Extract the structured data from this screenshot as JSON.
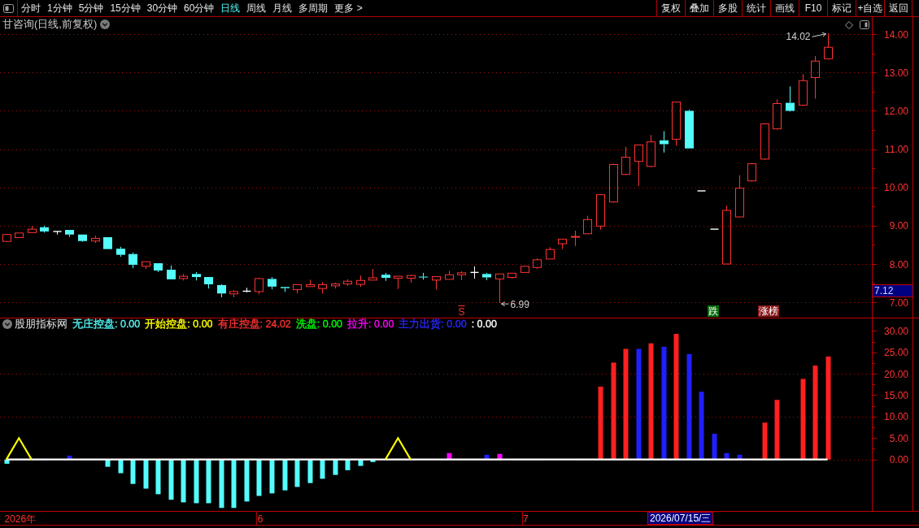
{
  "toolbar": {
    "periods": [
      {
        "label": "分时",
        "selected": false
      },
      {
        "label": "1分钟",
        "selected": false
      },
      {
        "label": "5分钟",
        "selected": false
      },
      {
        "label": "15分钟",
        "selected": false
      },
      {
        "label": "30分钟",
        "selected": false
      },
      {
        "label": "60分钟",
        "selected": false
      },
      {
        "label": "日线",
        "selected": true
      },
      {
        "label": "周线",
        "selected": false
      },
      {
        "label": "月线",
        "selected": false
      },
      {
        "label": "多周期",
        "selected": false
      },
      {
        "label": "更多 >",
        "selected": false
      }
    ],
    "buttons": [
      "复权",
      "叠加",
      "多股",
      "统计",
      "画线",
      "F10",
      "标记",
      "+自选",
      "返回"
    ]
  },
  "price_pane": {
    "title": "甘咨询(日线,前复权)",
    "markers": [
      {
        "kind": "signal",
        "text": "S"
      },
      {
        "kind": "tag",
        "text": "跌",
        "color": "#0b6b0b"
      },
      {
        "kind": "tag",
        "text": "涨榜",
        "color": "#8b1a1a"
      }
    ],
    "chart_data": [
      {
        "type": "candlestick",
        "ohlc": [
          [
            8.59,
            8.79,
            8.59,
            8.77
          ],
          [
            8.69,
            8.81,
            8.69,
            8.81
          ],
          [
            8.82,
            8.99,
            8.82,
            8.91
          ],
          [
            8.96,
            9,
            8.82,
            8.85
          ],
          [
            8.85,
            8.85,
            8.77,
            8.85
          ],
          [
            8.89,
            8.89,
            8.71,
            8.77
          ],
          [
            8.77,
            8.77,
            8.58,
            8.6
          ],
          [
            8.6,
            8.74,
            8.55,
            8.67
          ],
          [
            8.7,
            8.7,
            8.39,
            8.39
          ],
          [
            8.4,
            8.45,
            8.19,
            8.24
          ],
          [
            8.26,
            8.3,
            7.89,
            7.98
          ],
          [
            7.94,
            8.06,
            7.87,
            8.06
          ],
          [
            8.02,
            8.02,
            7.79,
            7.83
          ],
          [
            7.85,
            7.96,
            7.6,
            7.6
          ],
          [
            7.62,
            7.74,
            7.57,
            7.68
          ],
          [
            7.74,
            7.79,
            7.57,
            7.66
          ],
          [
            7.66,
            7.66,
            7.36,
            7.47
          ],
          [
            7.45,
            7.47,
            7.13,
            7.23
          ],
          [
            7.22,
            7.32,
            7.13,
            7.28
          ],
          [
            7.29,
            7.38,
            7.26,
            7.29
          ],
          [
            7.28,
            7.64,
            7.21,
            7.62
          ],
          [
            7.61,
            7.66,
            7.34,
            7.41
          ],
          [
            7.4,
            7.4,
            7.27,
            7.37
          ],
          [
            7.33,
            7.46,
            7.23,
            7.46
          ],
          [
            7.41,
            7.59,
            7.41,
            7.46
          ],
          [
            7.36,
            7.53,
            7.23,
            7.46
          ],
          [
            7.43,
            7.51,
            7.36,
            7.48
          ],
          [
            7.48,
            7.6,
            7.43,
            7.55
          ],
          [
            7.47,
            7.7,
            7.4,
            7.57
          ],
          [
            7.58,
            7.87,
            7.58,
            7.64
          ],
          [
            7.72,
            7.77,
            7.56,
            7.64
          ],
          [
            7.63,
            7.68,
            7.35,
            7.68
          ],
          [
            7.63,
            7.72,
            7.51,
            7.7
          ],
          [
            7.67,
            7.77,
            7.59,
            7.66
          ],
          [
            7.58,
            7.67,
            7.33,
            7.67
          ],
          [
            7.6,
            7.82,
            7.6,
            7.72
          ],
          [
            7.72,
            7.81,
            7.58,
            7.77
          ],
          [
            7.78,
            7.94,
            7.62,
            7.78
          ],
          [
            7.74,
            7.77,
            7.58,
            7.65
          ],
          [
            7.61,
            7.74,
            6.99,
            7.74
          ],
          [
            7.65,
            7.76,
            7.62,
            7.76
          ],
          [
            7.78,
            7.94,
            7.78,
            7.94
          ],
          [
            7.91,
            8.15,
            7.87,
            8.11
          ],
          [
            8.13,
            8.44,
            8.12,
            8.38
          ],
          [
            8.53,
            8.65,
            8.39,
            8.65
          ],
          [
            8.7,
            8.87,
            8.47,
            8.72
          ],
          [
            8.79,
            9.26,
            8.79,
            9.16
          ],
          [
            8.99,
            9.83,
            8.9,
            9.81
          ],
          [
            9.62,
            10.62,
            9.6,
            10.6
          ],
          [
            10.34,
            11.06,
            10.32,
            10.79
          ],
          [
            10.68,
            11.11,
            10.04,
            11.11
          ],
          [
            10.55,
            11.37,
            10.53,
            11.19
          ],
          [
            11.23,
            11.47,
            10.91,
            11.13
          ],
          [
            11.26,
            12.23,
            11.09,
            12.23
          ],
          [
            12,
            12.03,
            11.02,
            11.02
          ],
          [
            9.91,
            9.91,
            9.91,
            9.91
          ],
          [
            8.91,
            8.91,
            8.91,
            8.91
          ],
          [
            8,
            9.52,
            8,
            9.4
          ],
          [
            9.23,
            10.32,
            9.23,
            9.98
          ],
          [
            10.17,
            10.64,
            10.15,
            10.62
          ],
          [
            10.74,
            11.68,
            10.72,
            11.66
          ],
          [
            11.53,
            12.3,
            11.51,
            12.19
          ],
          [
            12.21,
            12.64,
            11.98,
            12
          ],
          [
            12.15,
            12.96,
            12.13,
            12.79
          ],
          [
            12.87,
            13.43,
            12.32,
            13.3
          ],
          [
            13.36,
            14.02,
            13.34,
            13.66
          ],
          null,
          null,
          null
        ],
        "ylim": [
          6.6,
          14.45
        ],
        "yticks": [
          {
            "value": 7,
            "label": "7.00"
          },
          {
            "value": 8,
            "label": "8.00"
          },
          {
            "value": 9,
            "label": "9.00"
          },
          {
            "value": 10,
            "label": "10.00"
          },
          {
            "value": 11,
            "label": "11.00"
          },
          {
            "value": 12,
            "label": "12.00"
          },
          {
            "value": 13,
            "label": "13.00"
          },
          {
            "value": 14,
            "label": "14.00"
          }
        ],
        "grid": true,
        "annotations": [
          "14.02",
          "6.99"
        ]
      }
    ]
  },
  "indicator_pane": {
    "title": "股朋指标网",
    "legend": [
      {
        "text": "无庄控盘: 0.00",
        "color": "#54fcfc"
      },
      {
        "text": "开始控盘: 0.00",
        "color": "#ffff00"
      },
      {
        "text": "有庄控盘: 24.02",
        "color": "#ff3232"
      },
      {
        "text": "洗盘: 0.00",
        "color": "#00ff00"
      },
      {
        "text": "拉升: 0.00",
        "color": "#ff00ff"
      },
      {
        "text": "主力出货: 0.00",
        "color": "#2828ff"
      },
      {
        "text": ": 0.00",
        "color": "#ffffff"
      }
    ],
    "chart_data": [
      {
        "type": "bar",
        "categories": [
          null,
          "2026年",
          null,
          null,
          null,
          null,
          null,
          null,
          null,
          null,
          null,
          null,
          null,
          null,
          null,
          null,
          null,
          null,
          null,
          null,
          "6",
          null,
          null,
          null,
          null,
          null,
          null,
          null,
          null,
          null,
          null,
          null,
          null,
          null,
          null,
          null,
          null,
          null,
          null,
          null,
          null,
          "7",
          null,
          null,
          null,
          null,
          null,
          null,
          null,
          null,
          null,
          null,
          null,
          null,
          null,
          null,
          null,
          null,
          null,
          null,
          null,
          null,
          null,
          null,
          null,
          null,
          null,
          null,
          null
        ],
        "ylim": [
          -12.1,
          33
        ],
        "yticks": [
          {
            "value": 0,
            "label": "0.00"
          },
          {
            "value": 5,
            "label": "5.00"
          },
          {
            "value": 10,
            "label": "10.00"
          },
          {
            "value": 15,
            "label": "15.00"
          },
          {
            "value": 20,
            "label": "20.00"
          },
          {
            "value": 25,
            "label": "25.00"
          },
          {
            "value": 30,
            "label": "30.00"
          }
        ],
        "grid": true,
        "series": [
          {
            "color": "#54fcfc",
            "values": [
              -1,
              null,
              null,
              null,
              null,
              null,
              null,
              null,
              -1.7,
              -3.2,
              -5.7,
              -6.8,
              -8.1,
              -9.4,
              -10,
              -10.2,
              -10.2,
              -11.3,
              -11.3,
              -9.8,
              -8.5,
              -7.9,
              -7.2,
              -6.4,
              -5.5,
              -4.5,
              -3.6,
              -2.5,
              -1.5,
              -0.6,
              null,
              null,
              null,
              null,
              null,
              null,
              null,
              null,
              null,
              null,
              null,
              null,
              null,
              null,
              null,
              null,
              null,
              null,
              null,
              null,
              null,
              null,
              null,
              null,
              null,
              null,
              null,
              null,
              null,
              null,
              null,
              null,
              null,
              null,
              null,
              null,
              null,
              null,
              null
            ]
          },
          {
            "color": "#ff2020",
            "values": [
              null,
              null,
              null,
              null,
              null,
              null,
              null,
              null,
              null,
              null,
              null,
              null,
              null,
              null,
              null,
              null,
              null,
              null,
              null,
              null,
              null,
              null,
              null,
              null,
              null,
              null,
              null,
              null,
              null,
              null,
              null,
              null,
              null,
              null,
              null,
              null,
              null,
              null,
              null,
              null,
              null,
              null,
              null,
              null,
              null,
              null,
              null,
              17,
              22.6,
              25.8,
              null,
              27.1,
              null,
              29.3,
              null,
              null,
              null,
              null,
              null,
              null,
              8.6,
              13.9,
              null,
              18.8,
              21.9,
              24.02,
              null,
              null,
              null
            ]
          },
          {
            "color": "#ff00ff",
            "values": [
              null,
              null,
              null,
              null,
              null,
              null,
              null,
              null,
              null,
              null,
              null,
              null,
              null,
              null,
              null,
              null,
              null,
              null,
              null,
              null,
              null,
              null,
              null,
              null,
              null,
              null,
              null,
              null,
              null,
              null,
              null,
              null,
              null,
              null,
              null,
              1.5,
              null,
              null,
              null,
              1.3,
              null,
              null,
              null,
              null,
              null,
              null,
              null,
              null,
              null,
              null,
              null,
              null,
              null,
              null,
              null,
              null,
              null,
              null,
              null,
              null,
              null,
              null,
              null,
              null,
              null,
              null,
              null,
              null,
              null
            ]
          },
          {
            "color": "#2020ff",
            "values": [
              null,
              null,
              null,
              null,
              null,
              0.9,
              null,
              null,
              null,
              null,
              null,
              null,
              null,
              null,
              null,
              null,
              null,
              null,
              null,
              null,
              null,
              null,
              null,
              null,
              null,
              null,
              null,
              null,
              null,
              null,
              null,
              null,
              null,
              null,
              null,
              null,
              null,
              null,
              1.1,
              null,
              null,
              null,
              null,
              null,
              null,
              null,
              null,
              null,
              null,
              null,
              25.8,
              null,
              26.3,
              null,
              24.6,
              15.8,
              6,
              1.5,
              1.1,
              null,
              null,
              null,
              null,
              null,
              null,
              null,
              null,
              null,
              null
            ]
          },
          {
            "type": "line",
            "color": "#ffffff",
            "values": [
              0,
              0,
              0,
              0,
              0,
              0,
              0,
              0,
              0,
              0,
              0,
              0,
              0,
              0,
              0,
              0,
              0,
              0,
              0,
              0,
              0,
              0,
              0,
              0,
              0,
              0,
              0,
              0,
              0,
              0,
              0,
              0,
              0,
              0,
              0,
              0,
              0,
              0,
              0,
              0,
              0,
              0,
              0,
              0,
              0,
              0,
              0,
              0,
              0,
              0,
              0,
              0,
              0,
              0,
              0,
              0,
              0,
              0,
              0,
              0,
              0,
              0,
              0,
              0,
              0,
              0,
              null,
              null,
              null
            ]
          },
          {
            "type": "line",
            "color": "#ffff00",
            "values": [
              0,
              5,
              0,
              null,
              null,
              null,
              null,
              null,
              null,
              null,
              null,
              null,
              null,
              null,
              null,
              null,
              null,
              null,
              null,
              null,
              null,
              null,
              null,
              null,
              null,
              null,
              null,
              null,
              null,
              null,
              0,
              5,
              0,
              null,
              null,
              null,
              null,
              null,
              null,
              null,
              null,
              null,
              null,
              null,
              null,
              null,
              null,
              null,
              null,
              null,
              null,
              null,
              null,
              null,
              null,
              null,
              null,
              null,
              null,
              null,
              null,
              null,
              null,
              null,
              null,
              null,
              null,
              null,
              null
            ]
          }
        ]
      }
    ]
  },
  "cursor": {
    "price": "7.12",
    "date": "2026/07/15/三"
  }
}
